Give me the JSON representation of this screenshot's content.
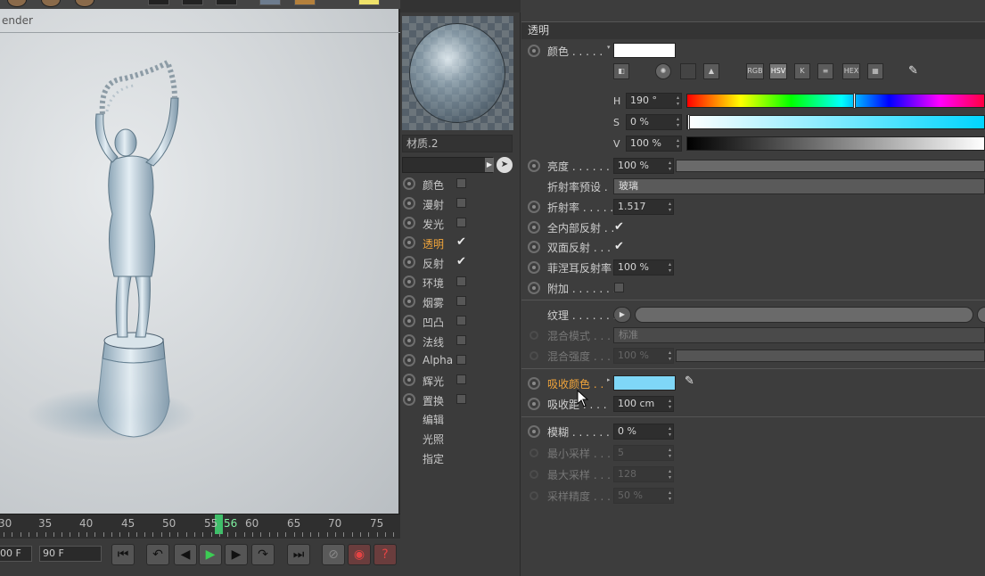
{
  "viewport": {
    "title": "ender"
  },
  "timeline": {
    "ticks": [
      "30",
      "35",
      "40",
      "45",
      "50",
      "55",
      "56",
      "60",
      "65",
      "70",
      "75"
    ]
  },
  "transport": {
    "start_field": "00 F",
    "end_field": "90 F"
  },
  "material": {
    "name": "材质.2",
    "channels": [
      {
        "label": "颜色",
        "checked": false,
        "active": false
      },
      {
        "label": "漫射",
        "checked": false,
        "active": false
      },
      {
        "label": "发光",
        "checked": false,
        "active": false
      },
      {
        "label": "透明",
        "checked": true,
        "active": true
      },
      {
        "label": "反射",
        "checked": true,
        "active": false
      },
      {
        "label": "环境",
        "checked": false,
        "active": false
      },
      {
        "label": "烟雾",
        "checked": false,
        "active": false
      },
      {
        "label": "凹凸",
        "checked": false,
        "active": false
      },
      {
        "label": "法线",
        "checked": false,
        "active": false
      },
      {
        "label": "Alpha",
        "checked": false,
        "active": false
      },
      {
        "label": "辉光",
        "checked": false,
        "active": false
      },
      {
        "label": "置换",
        "checked": false,
        "active": false
      }
    ],
    "extra": [
      "编辑",
      "光照",
      "指定"
    ]
  },
  "props": {
    "section": "透明",
    "color_label": "颜色 . . . . .",
    "color_value": "#ffffff",
    "color_modes": [
      "RGB",
      "HSV",
      "K",
      "",
      "HEX",
      ""
    ],
    "hsv": {
      "h_label": "H",
      "h_value": "190 °",
      "s_label": "S",
      "s_value": "0 %",
      "v_label": "V",
      "v_value": "100 %"
    },
    "brightness_label": "亮度 . . . . . . .",
    "brightness_value": "100 %",
    "ior_preset_label": "折射率预设 .",
    "ior_preset_value": "玻璃",
    "ior_label": "折射率 . . . . .",
    "ior_value": "1.517",
    "total_internal_label": "全内部反射 . .",
    "double_sided_label": "双面反射 . . .",
    "fresnel_label": "菲涅耳反射率",
    "fresnel_value": "100 %",
    "additive_label": "附加 . . . . . . .",
    "texture_label": "纹理 . . . . . . .",
    "blend_mode_label": "混合模式 . . .",
    "blend_mode_value": "标准",
    "blend_strength_label": "混合强度 . . .",
    "blend_strength_value": "100 %",
    "absorption_color_label": "吸收颜色 . .",
    "absorption_color_value": "#7fd7f7",
    "absorption_distance_label": "吸收距 . . . .",
    "absorption_distance_value": "100 cm",
    "blur_label": "模糊 . . . . . . .",
    "blur_value": "0 %",
    "min_samples_label": "最小采样 . . .",
    "min_samples_value": "5",
    "max_samples_label": "最大采样 . . .",
    "max_samples_value": "128",
    "accuracy_label": "采样精度 . . .",
    "accuracy_value": "50 %"
  }
}
